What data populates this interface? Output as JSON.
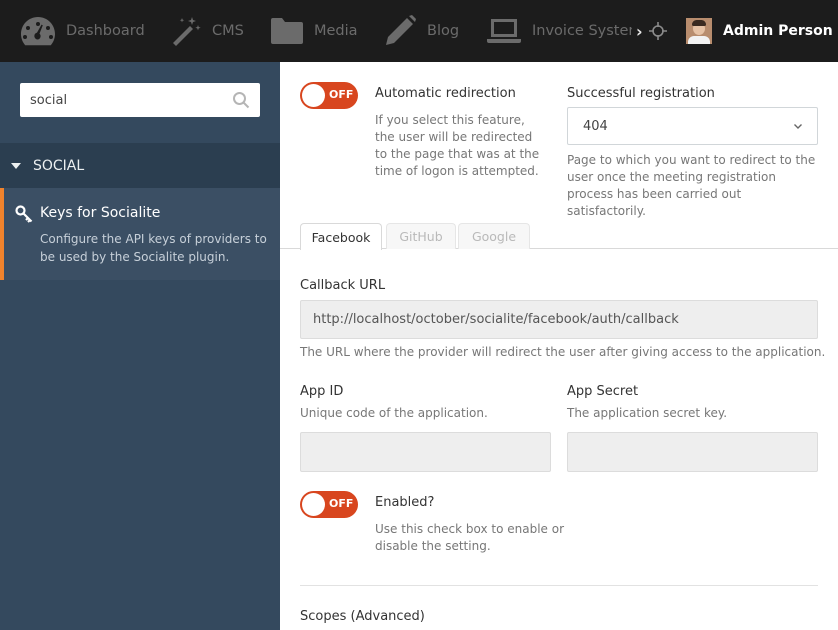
{
  "nav": {
    "items": [
      {
        "label": "Dashboard",
        "icon": "dashboard-icon"
      },
      {
        "label": "CMS",
        "icon": "magic-wand-icon"
      },
      {
        "label": "Media",
        "icon": "folder-icon"
      },
      {
        "label": "Blog",
        "icon": "pencil-icon"
      },
      {
        "label": "Invoice System",
        "icon": "laptop-icon"
      }
    ],
    "more_glyph": "›",
    "user_name": "Admin Person"
  },
  "sidebar": {
    "search": {
      "value": "social",
      "placeholder": ""
    },
    "section_label": "SOCIAL",
    "item": {
      "title": "Keys for Socialite",
      "description": "Configure the API keys of providers to be used by the Socialite plugin."
    }
  },
  "form": {
    "auto_redirect": {
      "switch_text": "OFF",
      "label": "Automatic redirection",
      "help": "If you select this feature, the user will be redirected to the page that was at the time of logon is attempted."
    },
    "successful_registration": {
      "label": "Successful registration",
      "value": "404",
      "help": "Page to which you want to redirect to the user once the meeting registration process has been carried out satisfactorily."
    },
    "tabs": [
      {
        "label": "Facebook",
        "active": true
      },
      {
        "label": "GitHub",
        "active": false
      },
      {
        "label": "Google",
        "active": false
      }
    ],
    "callback_url": {
      "label": "Callback URL",
      "value": "http://localhost/october/socialite/facebook/auth/callback",
      "help": "The URL where the provider will redirect the user after giving access to the application."
    },
    "app_id": {
      "label": "App ID",
      "help": "Unique code of the application.",
      "value": ""
    },
    "app_secret": {
      "label": "App Secret",
      "help": "The application secret key.",
      "value": ""
    },
    "enabled": {
      "switch_text": "OFF",
      "label": "Enabled?",
      "help": "Use this check box to enable or disable the setting."
    },
    "scopes": {
      "label": "Scopes (Advanced)"
    }
  },
  "colors": {
    "topbar": "#1c1c1c",
    "sidebar": "#34495e",
    "accent": "#f0832d",
    "switch_off": "#d8461f"
  }
}
